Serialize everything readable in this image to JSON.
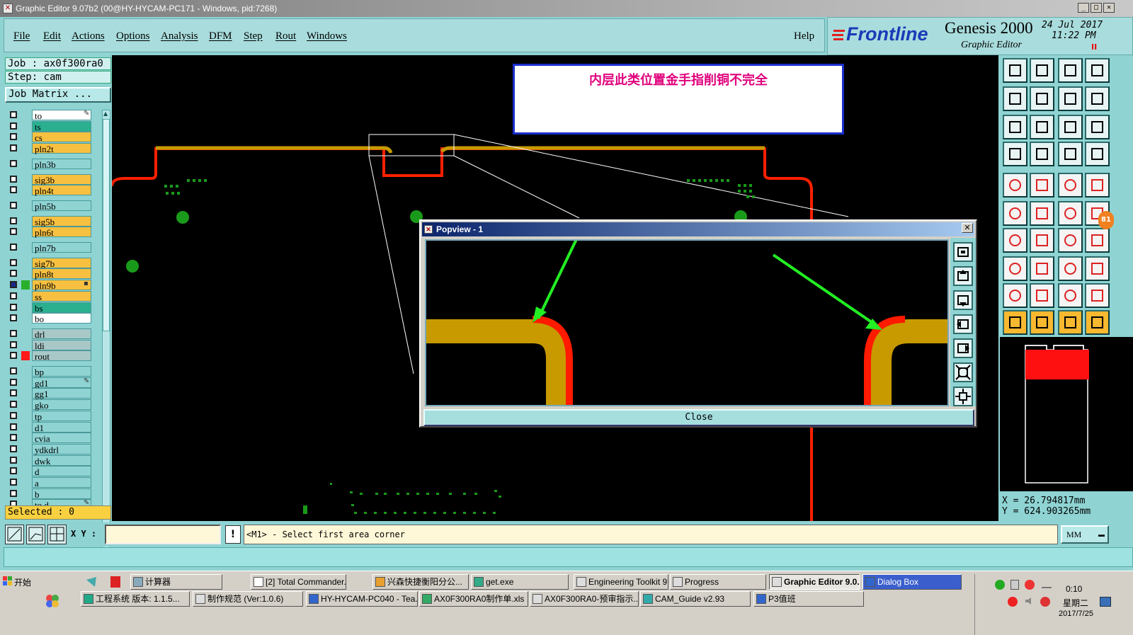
{
  "window": {
    "title": "Graphic Editor 9.07b2 (00@HY-HYCAM-PC171 - Windows, pid:7268)",
    "min": "_",
    "max": "□",
    "close": "✕"
  },
  "menu": {
    "items": [
      "File",
      "Edit",
      "Actions",
      "Options",
      "Analysis",
      "DFM",
      "Step",
      "Rout",
      "Windows"
    ],
    "help": "Help"
  },
  "brand": {
    "logo": "Frontline",
    "product": "Genesis 2000",
    "subtitle": "Graphic Editor",
    "date": "24 Jul 2017",
    "time": "11:22 PM",
    "pause": "II"
  },
  "job": {
    "job_label": "Job : ax0f300ra0",
    "step_label": "Step: cam",
    "matrix_button": "Job Matrix ..."
  },
  "layers": [
    {
      "name": "to",
      "color": "#ffffff",
      "swatch": "",
      "mark": "✎"
    },
    {
      "name": "ts",
      "color": "#2aaf8f",
      "swatch": ""
    },
    {
      "name": "cs",
      "color": "#f8c040",
      "swatch": ""
    },
    {
      "name": "pln2t",
      "color": "#f8c040",
      "swatch": ""
    },
    {
      "name": "pln3b",
      "color": "#8fd3d3",
      "swatch": "",
      "gap": true
    },
    {
      "name": "sig3b",
      "color": "#f8c040",
      "swatch": "",
      "gap": true
    },
    {
      "name": "pln4t",
      "color": "#f8c040",
      "swatch": ""
    },
    {
      "name": "pln5b",
      "color": "#8fd3d3",
      "swatch": "",
      "gap": true
    },
    {
      "name": "sig5b",
      "color": "#f8c040",
      "swatch": "",
      "gap": true
    },
    {
      "name": "pln6t",
      "color": "#f8c040",
      "swatch": ""
    },
    {
      "name": "pln7b",
      "color": "#8fd3d3",
      "swatch": "",
      "gap": true
    },
    {
      "name": "sig7b",
      "color": "#f8c040",
      "swatch": "",
      "gap": true
    },
    {
      "name": "pln8t",
      "color": "#f8c040",
      "swatch": ""
    },
    {
      "name": "pln9b",
      "color": "#f8c040",
      "swatch": "#2aaf2a",
      "mark": "▪",
      "selected": true
    },
    {
      "name": "ss",
      "color": "#f8c040",
      "swatch": ""
    },
    {
      "name": "bs",
      "color": "#2aaf8f",
      "swatch": ""
    },
    {
      "name": "bo",
      "color": "#ffffff",
      "swatch": ""
    },
    {
      "name": "drl",
      "color": "#a8c8c8",
      "swatch": "",
      "gap": true
    },
    {
      "name": "ldi",
      "color": "#a8c8c8",
      "swatch": ""
    },
    {
      "name": "rout",
      "color": "#a8c8c8",
      "swatch": "#ff1a1a"
    },
    {
      "name": "bp",
      "color": "#8fd3d3",
      "swatch": "",
      "gap": true
    },
    {
      "name": "gd1",
      "color": "#8fd3d3",
      "swatch": "",
      "mark": "✎"
    },
    {
      "name": "gg1",
      "color": "#8fd3d3",
      "swatch": ""
    },
    {
      "name": "gko",
      "color": "#8fd3d3",
      "swatch": ""
    },
    {
      "name": "tp",
      "color": "#8fd3d3",
      "swatch": ""
    },
    {
      "name": "d1",
      "color": "#8fd3d3",
      "swatch": ""
    },
    {
      "name": "cvia",
      "color": "#8fd3d3",
      "swatch": ""
    },
    {
      "name": "ydkdrl",
      "color": "#8fd3d3",
      "swatch": ""
    },
    {
      "name": "dwk",
      "color": "#8fd3d3",
      "swatch": ""
    },
    {
      "name": "d",
      "color": "#8fd3d3",
      "swatch": ""
    },
    {
      "name": "a",
      "color": "#8fd3d3",
      "swatch": ""
    },
    {
      "name": "b",
      "color": "#8fd3d3",
      "swatch": ""
    },
    {
      "name": "to.d",
      "color": "#8fd3d3",
      "swatch": "",
      "mark": "✎"
    }
  ],
  "selected_count": "Selected : 0",
  "note_text": "内层此类位置金手指削铜不完全",
  "popview": {
    "title": "Popview - 1",
    "close_x": "✕",
    "close_button": "Close"
  },
  "coords": {
    "x": "X = 26.794817mm",
    "y": "Y = 624.903265mm"
  },
  "bottom": {
    "xy_label": "X Y :",
    "prompt": "<M1> - Select first area corner",
    "units": "MM",
    "badge": "81"
  },
  "taskbar": {
    "start": "开始",
    "row1": [
      "计算器",
      "[2] Total Commander...",
      "兴森快捷衡阳分公...",
      "get.exe",
      "Engineering Toolkit 9....",
      "Progress",
      "Graphic Editor 9.0...",
      "Dialog Box"
    ],
    "row2": [
      "工程系统  版本: 1.1.5...",
      "制作规范 (Ver:1.0.6)",
      "HY-HYCAM-PC040 - Tea...",
      "AX0F300RA0制作单.xls ...",
      "AX0F300RA0-预审指示....",
      "CAM_Guide v2.93",
      "P3值班"
    ],
    "clock": "0:10",
    "weekday": "星期二",
    "date": "2017/7/25"
  },
  "colors": {
    "copper": "#c89a00",
    "route": "#ff2000",
    "pad": "#1a9a1a",
    "arrow": "#22ee22"
  }
}
